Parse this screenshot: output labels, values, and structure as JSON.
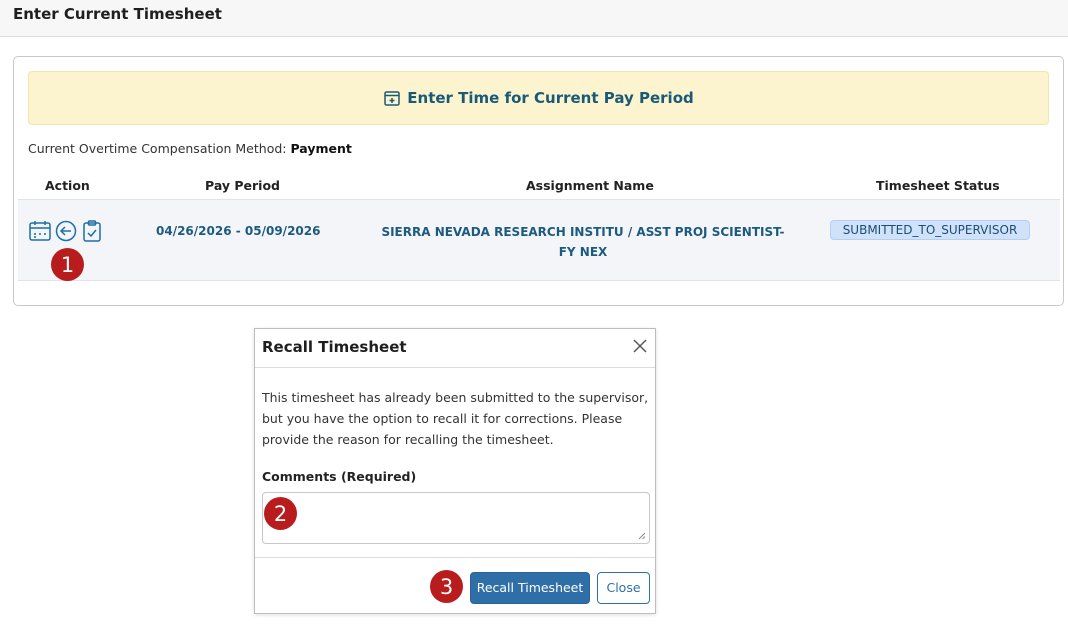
{
  "page": {
    "title": "Enter Current Timesheet"
  },
  "banner": {
    "label": "Enter Time for Current Pay Period",
    "icon": "calendar-plus-icon"
  },
  "overtime": {
    "prefix": "Current Overtime Compensation Method:",
    "value": "Payment"
  },
  "table": {
    "headers": {
      "action": "Action",
      "pay_period": "Pay Period",
      "assignment": "Assignment Name",
      "status": "Timesheet Status"
    },
    "rows": [
      {
        "pay_period": "04/26/2026 - 05/09/2026",
        "assignment": "SIERRA NEVADA RESEARCH INSTITU / ASST PROJ SCIENTIST-FY NEX",
        "status": "SUBMITTED_TO_SUPERVISOR",
        "action_icons": [
          "calendar-icon",
          "recall-arrow-icon",
          "clipboard-check-icon"
        ]
      }
    ]
  },
  "modal": {
    "title": "Recall Timesheet",
    "body": "This timesheet has already been submitted to the supervisor, but you have the option to recall it for corrections. Please provide the reason for recalling the timesheet.",
    "comments_label": "Comments (Required)",
    "comments_value": "",
    "recall_button": "Recall Timesheet",
    "close_button": "Close"
  },
  "markers": {
    "one": "1",
    "two": "2",
    "three": "3"
  },
  "colors": {
    "accent": "#2f6fa7",
    "banner_bg": "#fcf3cf",
    "link_text": "#1d5a7f",
    "marker": "#b91c1c",
    "badge_bg": "#cfe2fa"
  }
}
